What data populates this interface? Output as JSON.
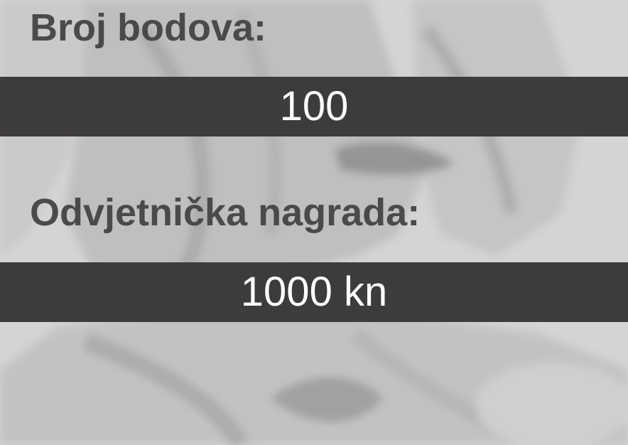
{
  "points": {
    "label": "Broj bodova:",
    "value": "100"
  },
  "reward": {
    "label": "Odvjetnička nagrada:",
    "value": "1000 kn"
  },
  "colors": {
    "background": "#d6d6d6",
    "label_text": "#4a4a4a",
    "bar": "#3e3c3b",
    "value_text": "#ffffff"
  },
  "background_image": "statue-drapery-photo"
}
